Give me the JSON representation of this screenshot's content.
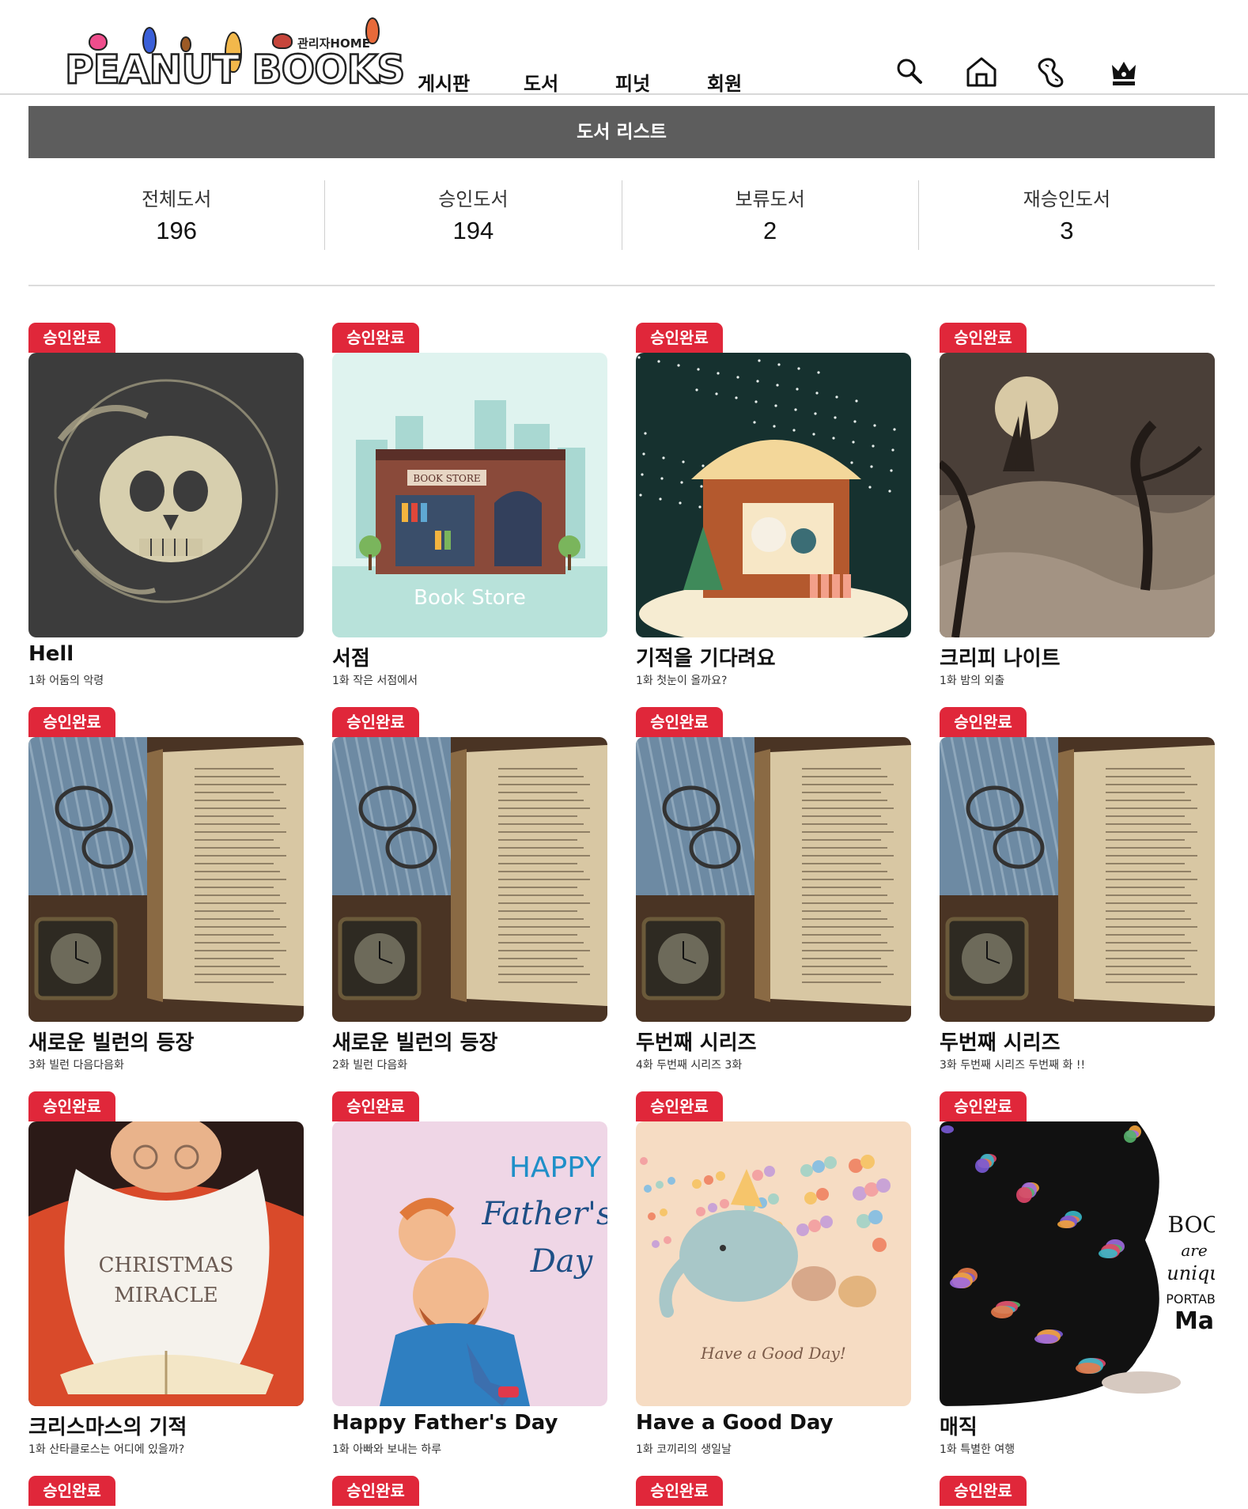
{
  "header": {
    "logo_text": "PEANUT BOOKS",
    "admin_home": "관리자HOME",
    "nav": [
      "게시판",
      "도서",
      "피넛",
      "회원"
    ],
    "icons": [
      "search-icon",
      "home-icon",
      "peanut-icon",
      "crown-icon"
    ]
  },
  "page": {
    "title": "도서 리스트"
  },
  "stats": [
    {
      "label": "전체도서",
      "value": "196"
    },
    {
      "label": "승인도서",
      "value": "194"
    },
    {
      "label": "보류도서",
      "value": "2"
    },
    {
      "label": "재승인도서",
      "value": "3"
    }
  ],
  "colors": {
    "badge": "#e0273a",
    "titlebar": "#5d5d5d"
  },
  "books": [
    {
      "badge": "승인완료",
      "title": "Hell",
      "subtitle": "1화 어둠의 악령",
      "cover": "skull"
    },
    {
      "badge": "승인완료",
      "title": "서점",
      "subtitle": "1화 작은 서점에서",
      "cover": "bookstore",
      "cover_text": "Book Store",
      "sign_text": "BOOK STORE"
    },
    {
      "badge": "승인완료",
      "title": "기적을 기다려요",
      "subtitle": "1화 첫눈이 올까요?",
      "cover": "winter-house"
    },
    {
      "badge": "승인완료",
      "title": "크리피 나이트",
      "subtitle": "1화 밤의 외출",
      "cover": "creepy-night"
    },
    {
      "badge": "승인완료",
      "title": "새로운 빌런의 등장",
      "subtitle": "3화 빌런 다음다음화",
      "cover": "old-book"
    },
    {
      "badge": "승인완료",
      "title": "새로운 빌런의 등장",
      "subtitle": "2화 빌런 다음화",
      "cover": "old-book"
    },
    {
      "badge": "승인완료",
      "title": "두번째 시리즈",
      "subtitle": "4화 두번째 시리즈 3화",
      "cover": "old-book"
    },
    {
      "badge": "승인완료",
      "title": "두번째 시리즈",
      "subtitle": "3화 두번째 시리즈 두번째 화 !!",
      "cover": "old-book"
    },
    {
      "badge": "승인완료",
      "title": "크리스마스의 기적",
      "subtitle": "1화 산타클로스는 어디에 있을까?",
      "cover": "santa"
    },
    {
      "badge": "승인완료",
      "title": "Happy Father's Day",
      "subtitle": "1화 아빠와 보내는 하루",
      "cover": "fathers-day",
      "cover_text": "HAPPY Father's Day"
    },
    {
      "badge": "승인완료",
      "title": "Have a Good Day",
      "subtitle": "1화 코끼리의 생일날",
      "cover": "elephant",
      "cover_text": "Have a Good Day!"
    },
    {
      "badge": "승인완료",
      "title": "매직",
      "subtitle": "1화 특별한 여행",
      "cover": "magic"
    }
  ],
  "next_row_badges": [
    "승인완료",
    "승인완료",
    "승인완료",
    "승인완료"
  ]
}
